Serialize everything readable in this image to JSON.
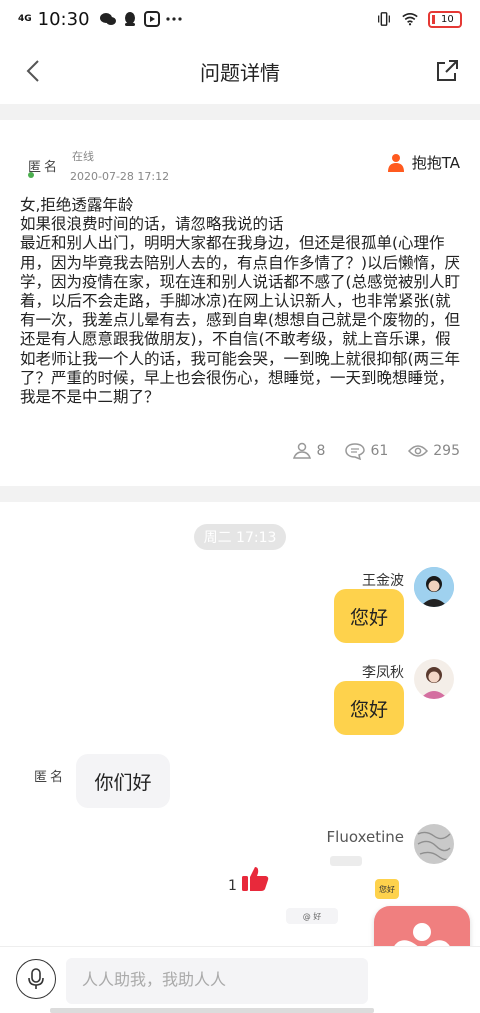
{
  "status_bar": {
    "network": "4G",
    "time": "10:30",
    "battery": "10"
  },
  "nav": {
    "title": "问题详情"
  },
  "question": {
    "author": "匿名",
    "online": "在线",
    "date": "2020-07-28 17:12",
    "hug_label": "抱抱TA",
    "body": "女,拒绝透露年龄\n如果很浪费时间的话，请忽略我说的话\n最近和别人出门，明明大家都在我身边，但还是很孤单(心理作用，因为毕竟我去陪别人去的，有点自作多情了？)以后懒惰，厌学，因为疫情在家，现在连和别人说话都不感了(总感觉被别人盯着，以后不会走路，手脚冰凉)在网上认识新人，也非常紧张(就有一次，我差点儿晕有去，感到自卑(想想自己就是个废物的，但还是有人愿意跟我做朋友)，不自信(不敢考级，就上音乐课，假如老师让我一个人的话，我可能会哭，一到晚上就很抑郁(两三年了？严重的时候，早上也会很伤心，想睡觉，一天到晚想睡觉，我是不是中二期了？",
    "hugs": "8",
    "comments": "61",
    "views": "295"
  },
  "chat": {
    "time_pill": "周二 17:13",
    "messages": [
      {
        "name": "王金波",
        "text": "您好"
      },
      {
        "name": "李凤秋",
        "text": "您好"
      },
      {
        "name": "匿名",
        "text": "你们好"
      },
      {
        "name": "Fluoxetine",
        "mini_text": "您好",
        "mini_reply": "@ 好"
      }
    ],
    "like_count": "1"
  },
  "input": {
    "placeholder": "人人助我，我助人人"
  },
  "colors": {
    "accent": "#fed24c",
    "hug": "#ff5a1f",
    "like": "#e8293b",
    "heart_bg": "#f07f7f"
  }
}
